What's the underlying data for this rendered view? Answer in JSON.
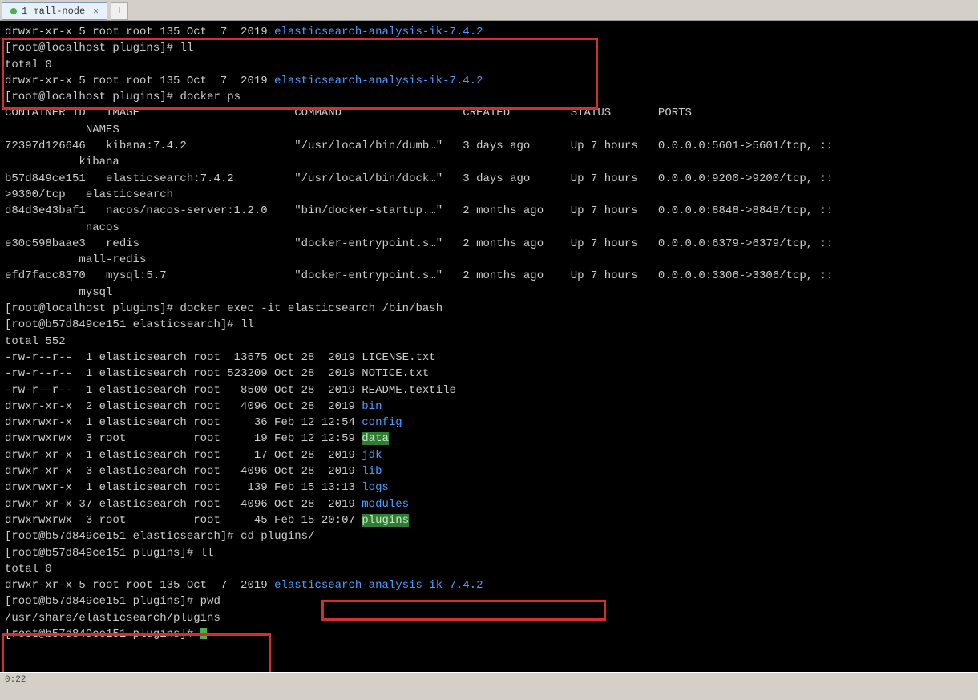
{
  "tabs": {
    "active": "1 mall-node"
  },
  "term": {
    "line_top": "drwxr-xr-x 5 root root 135 Oct  7  2019 ",
    "top_dir": "elasticsearch-analysis-ik-7.4.2",
    "prompt1": "[root@localhost plugins]# ",
    "cmd_ll": "ll",
    "total0": "total 0",
    "line_dir": "drwxr-xr-x 5 root root 135 Oct  7  2019 ",
    "dir1": "elasticsearch-analysis-ik-7.4.2",
    "cmd_dockerps": "docker ps",
    "dheader": "CONTAINER ID   IMAGE                       COMMAND                  CREATED         STATUS       PORTS",
    "dheader2": "            NAMES",
    "r1": "72397d126646   kibana:7.4.2                \"/usr/local/bin/dumb…\"   3 days ago      Up 7 hours   0.0.0.0:5601->5601/tcp, ::",
    "r1b": "           kibana",
    "r2": "b57d849ce151   elasticsearch:7.4.2         \"/usr/local/bin/dock…\"   3 days ago      Up 7 hours   0.0.0.0:9200->9200/tcp, ::",
    "r2b": ">9300/tcp   elasticsearch",
    "r3": "d84d3e43baf1   nacos/nacos-server:1.2.0    \"bin/docker-startup.…\"   2 months ago    Up 7 hours   0.0.0.0:8848->8848/tcp, ::",
    "r3b": "            nacos",
    "r4": "e30c598baae3   redis                       \"docker-entrypoint.s…\"   2 months ago    Up 7 hours   0.0.0.0:6379->6379/tcp, ::",
    "r4b": "           mall-redis",
    "r5": "efd7facc8370   mysql:5.7                   \"docker-entrypoint.s…\"   2 months ago    Up 7 hours   0.0.0.0:3306->3306/tcp, ::",
    "r5b": "           mysql",
    "cmd_exec": "docker exec -it elasticsearch /bin/bash",
    "prompt2": "[root@b57d849ce151 elasticsearch]# ",
    "total552": "total 552",
    "f1": "-rw-r--r--  1 elasticsearch root  13675 Oct 28  2019 LICENSE.txt",
    "f2": "-rw-r--r--  1 elasticsearch root 523209 Oct 28  2019 NOTICE.txt",
    "f3": "-rw-r--r--  1 elasticsearch root   8500 Oct 28  2019 README.textile",
    "d_bin_p": "drwxr-xr-x  2 elasticsearch root   4096 Oct 28  2019 ",
    "d_bin": "bin",
    "d_config_p": "drwxrwxr-x  1 elasticsearch root     36 Feb 12 12:54 ",
    "d_config": "config",
    "d_data_p": "drwxrwxrwx  3 root          root     19 Feb 12 12:59 ",
    "d_data": "data",
    "d_jdk_p": "drwxr-xr-x  1 elasticsearch root     17 Oct 28  2019 ",
    "d_jdk": "jdk",
    "d_lib_p": "drwxr-xr-x  3 elasticsearch root   4096 Oct 28  2019 ",
    "d_lib": "lib",
    "d_logs_p": "drwxrwxr-x  1 elasticsearch root    139 Feb 15 13:13 ",
    "d_logs": "logs",
    "d_modules_p": "drwxr-xr-x 37 elasticsearch root   4096 Oct 28  2019 ",
    "d_modules": "modules",
    "d_plugins_p": "drwxrwxrwx  3 root          root     45 Feb 15 20:07 ",
    "d_plugins": "plugins",
    "cmd_cd": "cd plugins/",
    "prompt3": "[root@b57d849ce151 plugins]# ",
    "d_es_p": "drwxr-xr-x 5 root root 135 Oct  7  2019 ",
    "d_es": "elasticsearch-analysis-ik-7.4.2",
    "cmd_pwd": "pwd",
    "pwd_out": "/usr/share/elasticsearch/plugins"
  },
  "status": {
    "left": "0:22"
  }
}
